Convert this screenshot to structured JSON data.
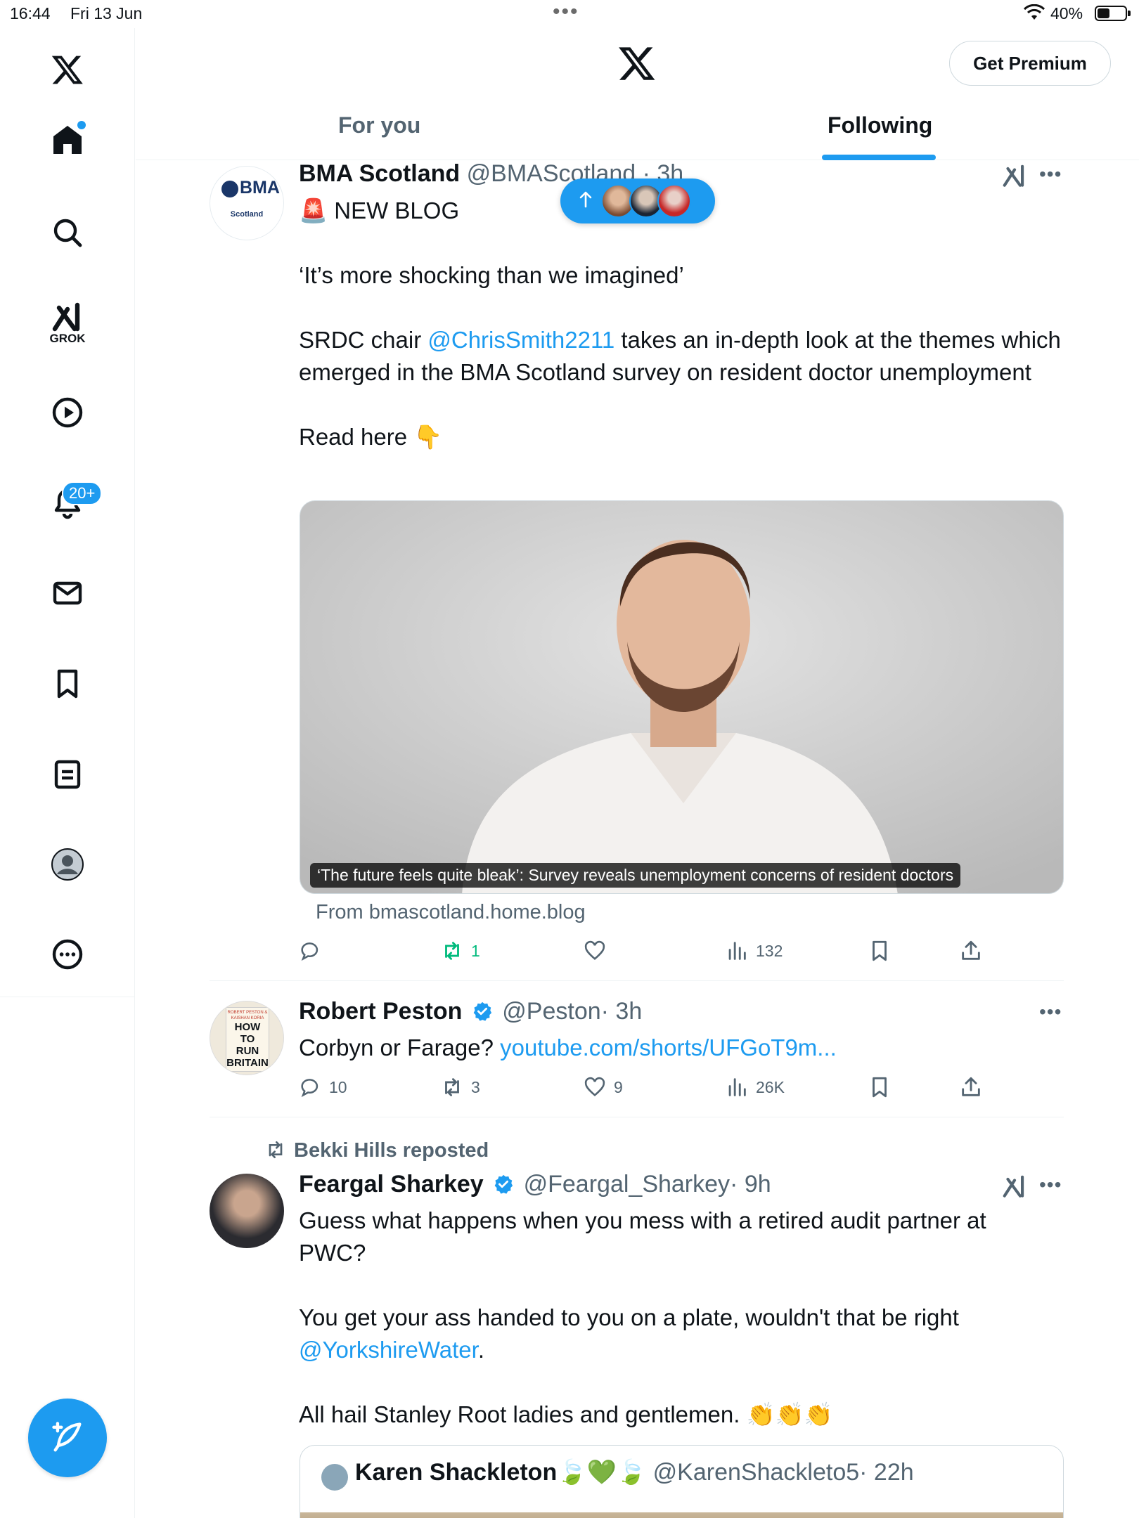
{
  "status_bar": {
    "time": "16:44",
    "date": "Fri 13 Jun",
    "battery": "40%"
  },
  "header": {
    "premium_label": "Get Premium"
  },
  "tabs": [
    {
      "label": "For you"
    },
    {
      "label": "Following"
    }
  ],
  "sidebar": {
    "grok_label": "GROK",
    "notifications_badge": "20+",
    "items": [
      "home-icon",
      "search-icon",
      "grok-icon",
      "video-icon",
      "notifications-icon",
      "messages-icon",
      "bookmarks-icon",
      "lists-icon",
      "profile-icon",
      "more-icon"
    ]
  },
  "new_posts_pill": {
    "icon": "arrow-up-icon"
  },
  "tweets": [
    {
      "name": "BMA Scotland",
      "handle": "@BMAScotland",
      "time": "· 3h",
      "avatar_text": "BMA",
      "avatar_sub": "Scotland",
      "line1": "🚨 NEW BLOG",
      "line2": "‘It’s more shocking than we imagined’",
      "line3_pre": "SRDC chair ",
      "line3_mention": "@ChrisSmith2211",
      "line3_post": "  takes an in-depth look at the themes which emerged in the BMA Scotland survey on resident doctor unemployment",
      "line4": "Read here 👇",
      "media_caption": "‘The future feels quite bleak’: Survey reveals unemployment concerns of resident doctors",
      "from": "From bmascotland.home.blog",
      "replies": "",
      "reposts": "1",
      "likes": "",
      "views": "132"
    },
    {
      "name": "Robert Peston",
      "handle": "@Peston",
      "time": "· 3h",
      "avatar_book": [
        "ROBERT PESTON & KAISHAN KORIA",
        "HOW TO",
        "RUN",
        "BRITAIN"
      ],
      "text_pre": "Corbyn or Farage? ",
      "text_link": "youtube.com/shorts/UFGoT9m...",
      "replies": "10",
      "reposts": "3",
      "likes": "9",
      "views": "26K"
    },
    {
      "repost_by": "Bekki Hills reposted",
      "name": "Feargal Sharkey",
      "handle": "@Feargal_Sharkey",
      "time": "· 9h",
      "para1": "Guess what happens when you mess with a retired audit partner at PWC?",
      "para2_pre": "You get your ass handed to you on a plate, wouldn't that be right ",
      "para2_mention": "@YorkshireWater",
      "para2_post": ".",
      "para3": "All hail Stanley Root ladies and gentlemen. 👏👏👏",
      "quote": {
        "name": "Karen Shackleton🍃💚🍃",
        "handle": "@KarenShackleto5",
        "time": "· 22h"
      }
    }
  ],
  "colors": {
    "accent": "#1d9bf0",
    "text": "#0f1419",
    "muted": "#536471",
    "repost_active": "#00ba7c"
  }
}
